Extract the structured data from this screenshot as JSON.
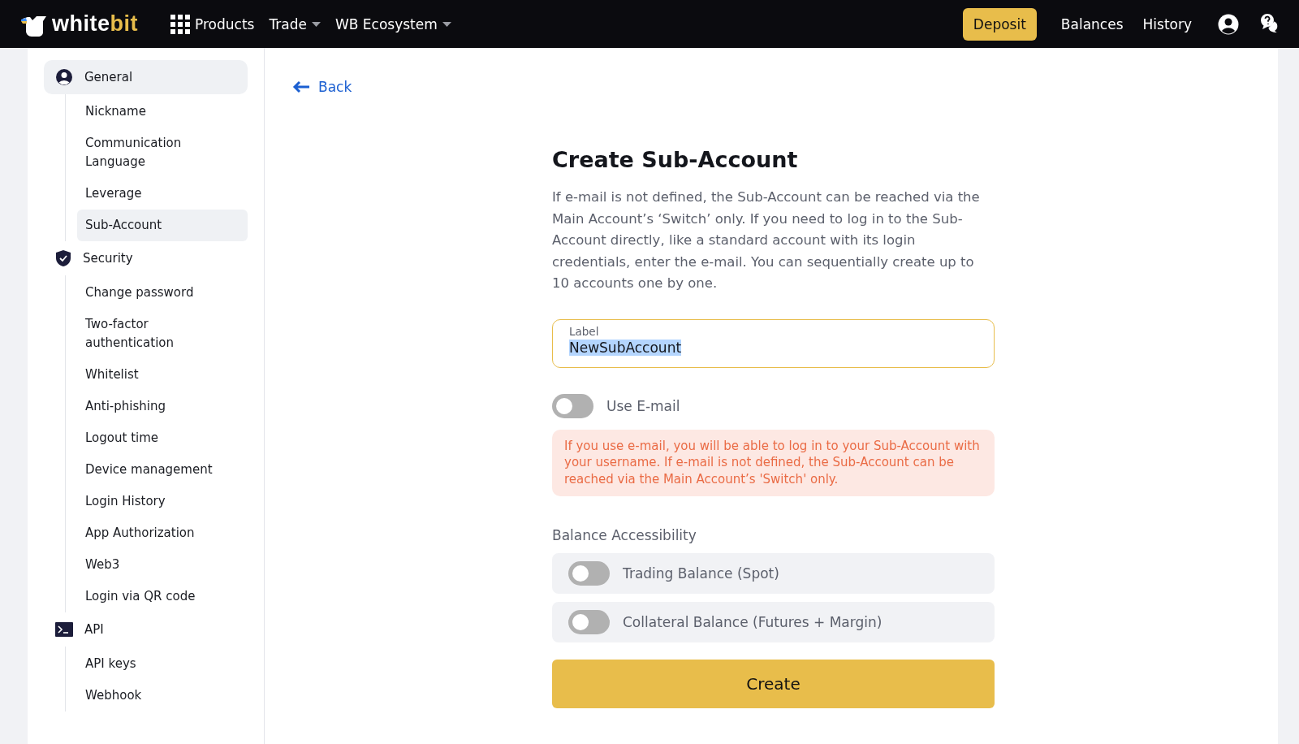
{
  "header": {
    "logo": {
      "main": "white",
      "accent": "bit"
    },
    "nav": [
      {
        "label": "Products",
        "kind": "grid"
      },
      {
        "label": "Trade",
        "kind": "dropdown"
      },
      {
        "label": "WB Ecosystem",
        "kind": "dropdown"
      }
    ],
    "deposit": "Deposit",
    "links": [
      "Balances",
      "History"
    ]
  },
  "sidebar": {
    "groups": [
      {
        "label": "General",
        "kind": "user",
        "selected": true,
        "children": [
          {
            "label": "Nickname",
            "selected": false
          },
          {
            "label": "Communication Language",
            "selected": false
          },
          {
            "label": "Leverage",
            "selected": false
          },
          {
            "label": "Sub-Account",
            "selected": true
          }
        ]
      },
      {
        "label": "Security",
        "kind": "shield",
        "selected": false,
        "children": [
          {
            "label": "Change password",
            "selected": false
          },
          {
            "label": "Two-factor authentication",
            "selected": false
          },
          {
            "label": "Whitelist",
            "selected": false
          },
          {
            "label": "Anti-phishing",
            "selected": false
          },
          {
            "label": "Logout time",
            "selected": false
          },
          {
            "label": "Device management",
            "selected": false
          },
          {
            "label": "Login History",
            "selected": false
          },
          {
            "label": "App Authorization",
            "selected": false
          },
          {
            "label": "Web3",
            "selected": false
          },
          {
            "label": "Login via QR code",
            "selected": false
          }
        ]
      },
      {
        "label": "API",
        "kind": "terminal",
        "selected": false,
        "children": [
          {
            "label": "API keys",
            "selected": false
          },
          {
            "label": "Webhook",
            "selected": false
          }
        ]
      }
    ]
  },
  "main": {
    "back": "Back",
    "title": "Create Sub-Account",
    "description": "If e-mail is not defined, the Sub-Account can be reached via the Main Account’s ‘Switch’ only. If you need to log in to the Sub-Account directly, like a standard account with its login credentials, enter the e-mail. You can sequentially create up to 10 accounts one by one.",
    "label_field": {
      "label": "Label",
      "value": "NewSubAccount",
      "highlighted": true
    },
    "use_email": {
      "label": "Use E-mail",
      "on": false
    },
    "warning": "If you use e-mail, you will be able to log in to your Sub-Account with your username. If e-mail is not defined, the Sub-Account can be reached via the Main Account’s 'Switch' only.",
    "balance_heading": "Balance Accessibility",
    "balances": [
      {
        "label": "Trading Balance (Spot)",
        "on": false
      },
      {
        "label": "Collateral Balance (Futures + Margin)",
        "on": false
      }
    ],
    "create": "Create"
  }
}
